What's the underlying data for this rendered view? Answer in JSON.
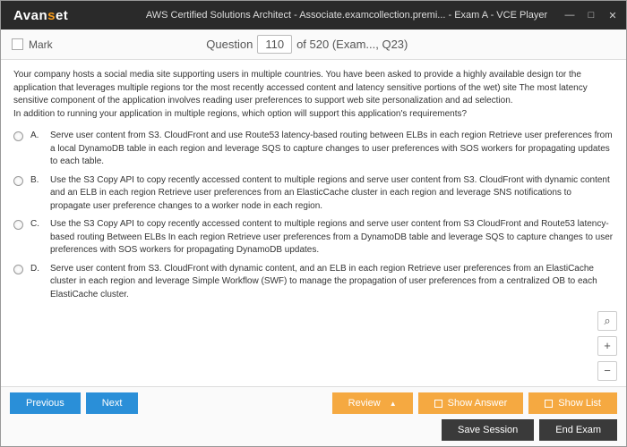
{
  "window": {
    "logo_pre": "Avan",
    "logo_accent": "s",
    "logo_post": "et",
    "title": "AWS Certified Solutions Architect - Associate.examcollection.premi... - Exam A - VCE Player"
  },
  "header": {
    "mark_label": "Mark",
    "question_label": "Question",
    "question_num": "110",
    "question_total": "of 520 (Exam..., Q23)"
  },
  "question": {
    "p1": "Your company hosts a social media site supporting users in multiple countries. You have been asked to provide a highly available design tor the application that leverages multiple regions tor the most recently accessed content and latency sensitive portions of the wet) site The most latency sensitive component of the application involves reading user preferences to support web site personalization and ad selection.",
    "p2": "In addition to running your application in multiple regions, which option will support this application's requirements?"
  },
  "options": [
    {
      "label": "A.",
      "text": "Serve user content from S3. CloudFront and use Route53 latency-based routing between ELBs in each region Retrieve user preferences from a local DynamoDB table in each region and leverage SQS to capture changes to user preferences with SOS workers for propagating updates to each table."
    },
    {
      "label": "B.",
      "text": "Use the S3 Copy API to copy recently accessed content to multiple regions and serve user content from S3. CloudFront with dynamic content and an ELB in each region Retrieve user preferences from an ElasticCache cluster in each region and leverage SNS notifications to propagate user preference changes to a worker node in each region."
    },
    {
      "label": "C.",
      "text": "Use the S3 Copy API to copy recently accessed content to multiple regions and serve user content from S3 CloudFront and Route53 latency-based routing Between ELBs In each region Retrieve user preferences from a DynamoDB table and leverage SQS to capture changes to user preferences with SOS workers for propagating DynamoDB updates."
    },
    {
      "label": "D.",
      "text": "Serve user content from S3. CloudFront with dynamic content, and an ELB in each region Retrieve user preferences from an ElastiCache cluster in each region and leverage Simple Workflow (SWF) to manage the propagation of user preferences from a centralized OB to each ElastiCache cluster."
    }
  ],
  "footer": {
    "previous": "Previous",
    "next": "Next",
    "review": "Review",
    "show_answer": "Show Answer",
    "show_list": "Show List",
    "save_session": "Save Session",
    "end_exam": "End Exam"
  },
  "zoom": {
    "search": "⌕",
    "plus": "+",
    "minus": "−"
  }
}
